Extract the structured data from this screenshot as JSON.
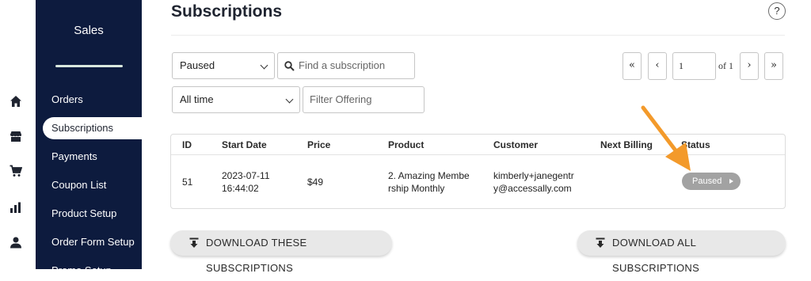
{
  "icon_rail": {
    "icons": [
      "home-icon",
      "store-icon",
      "cart-icon",
      "bar-chart-icon",
      "user-icon"
    ]
  },
  "sidebar": {
    "title": "Sales",
    "items": [
      {
        "label": "Orders",
        "active": false
      },
      {
        "label": "Subscriptions",
        "active": true
      },
      {
        "label": "Payments",
        "active": false
      },
      {
        "label": "Coupon List",
        "active": false
      },
      {
        "label": "Product Setup",
        "active": false
      },
      {
        "label": "Order Form Setup",
        "active": false
      },
      {
        "label": "Promo Setup",
        "active": false
      }
    ]
  },
  "header": {
    "title": "Subscriptions",
    "help_label": "?"
  },
  "filters": {
    "status_value": "Paused",
    "search_placeholder": "Find a subscription",
    "date_value": "All time",
    "offering_placeholder": "Filter Offering"
  },
  "pagination": {
    "first_label": "«",
    "prev_label": "‹",
    "current_page": "1",
    "of_label": "of 1",
    "next_label": "›",
    "last_label": "»"
  },
  "table": {
    "columns": [
      "ID",
      "Start Date",
      "Price",
      "Product",
      "Customer",
      "Next Billing",
      "Status"
    ],
    "rows": [
      {
        "id": "51",
        "start_date_line1": "2023-07-11",
        "start_date_line2": "16:44:02",
        "price": "$49",
        "product_line1": "2. Amazing Membe",
        "product_line2": "rship Monthly",
        "customer_line1": "kimberly+janegentr",
        "customer_line2": "y@accessally.com",
        "next_billing": "",
        "status": "Paused"
      }
    ]
  },
  "actions": {
    "download_these_label": "DOWNLOAD THESE SUBSCRIPTIONS",
    "download_all_label": "DOWNLOAD ALL SUBSCRIPTIONS"
  },
  "colors": {
    "sidebar_bg": "#0d1b3e",
    "status_paused": "#a2a2a2",
    "annotation_arrow": "#f39a2b",
    "button_bg": "#e8e8e8"
  }
}
